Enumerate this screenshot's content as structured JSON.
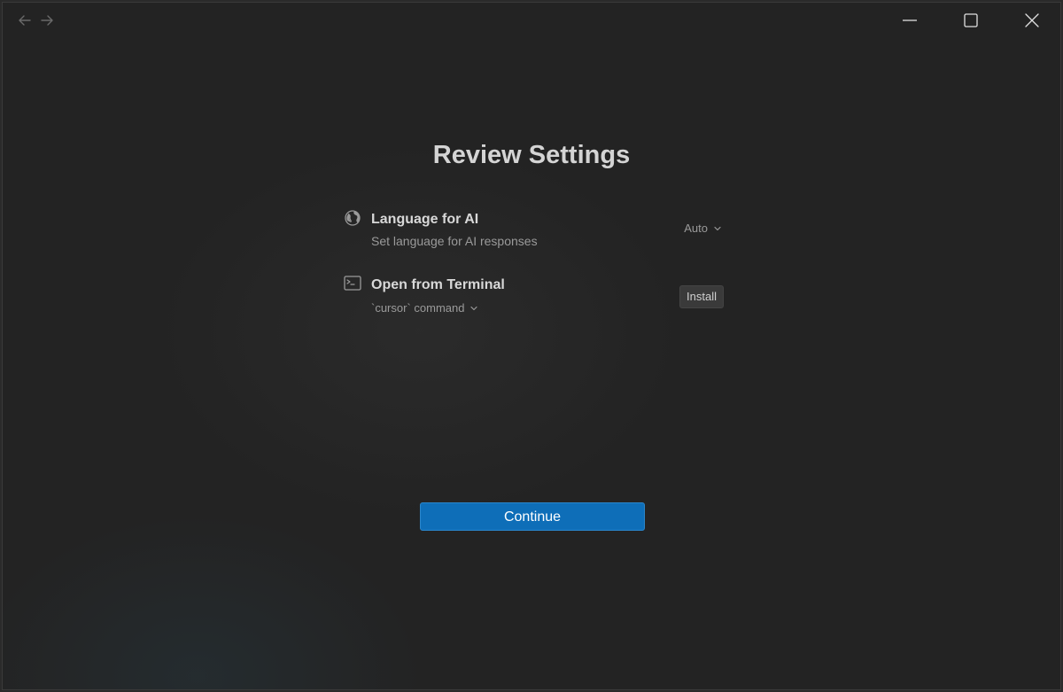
{
  "page": {
    "title": "Review Settings"
  },
  "titlebar": {
    "back_icon": "arrow-left-icon",
    "forward_icon": "arrow-right-icon",
    "minimize_icon": "minimize-icon",
    "maximize_icon": "maximize-icon",
    "close_icon": "close-icon"
  },
  "settings": [
    {
      "icon": "globe-icon",
      "label": "Language for AI",
      "description": "Set language for AI responses",
      "control_type": "dropdown",
      "value": "Auto"
    },
    {
      "icon": "terminal-icon",
      "label": "Open from Terminal",
      "sub_value": "`cursor` command",
      "control_type": "button",
      "button_label": "Install"
    }
  ],
  "actions": {
    "continue_label": "Continue"
  },
  "colors": {
    "background": "#232323",
    "accent": "#0e6eb8",
    "title_text": "#d4d4d4",
    "muted_text": "#9a9a9a"
  }
}
